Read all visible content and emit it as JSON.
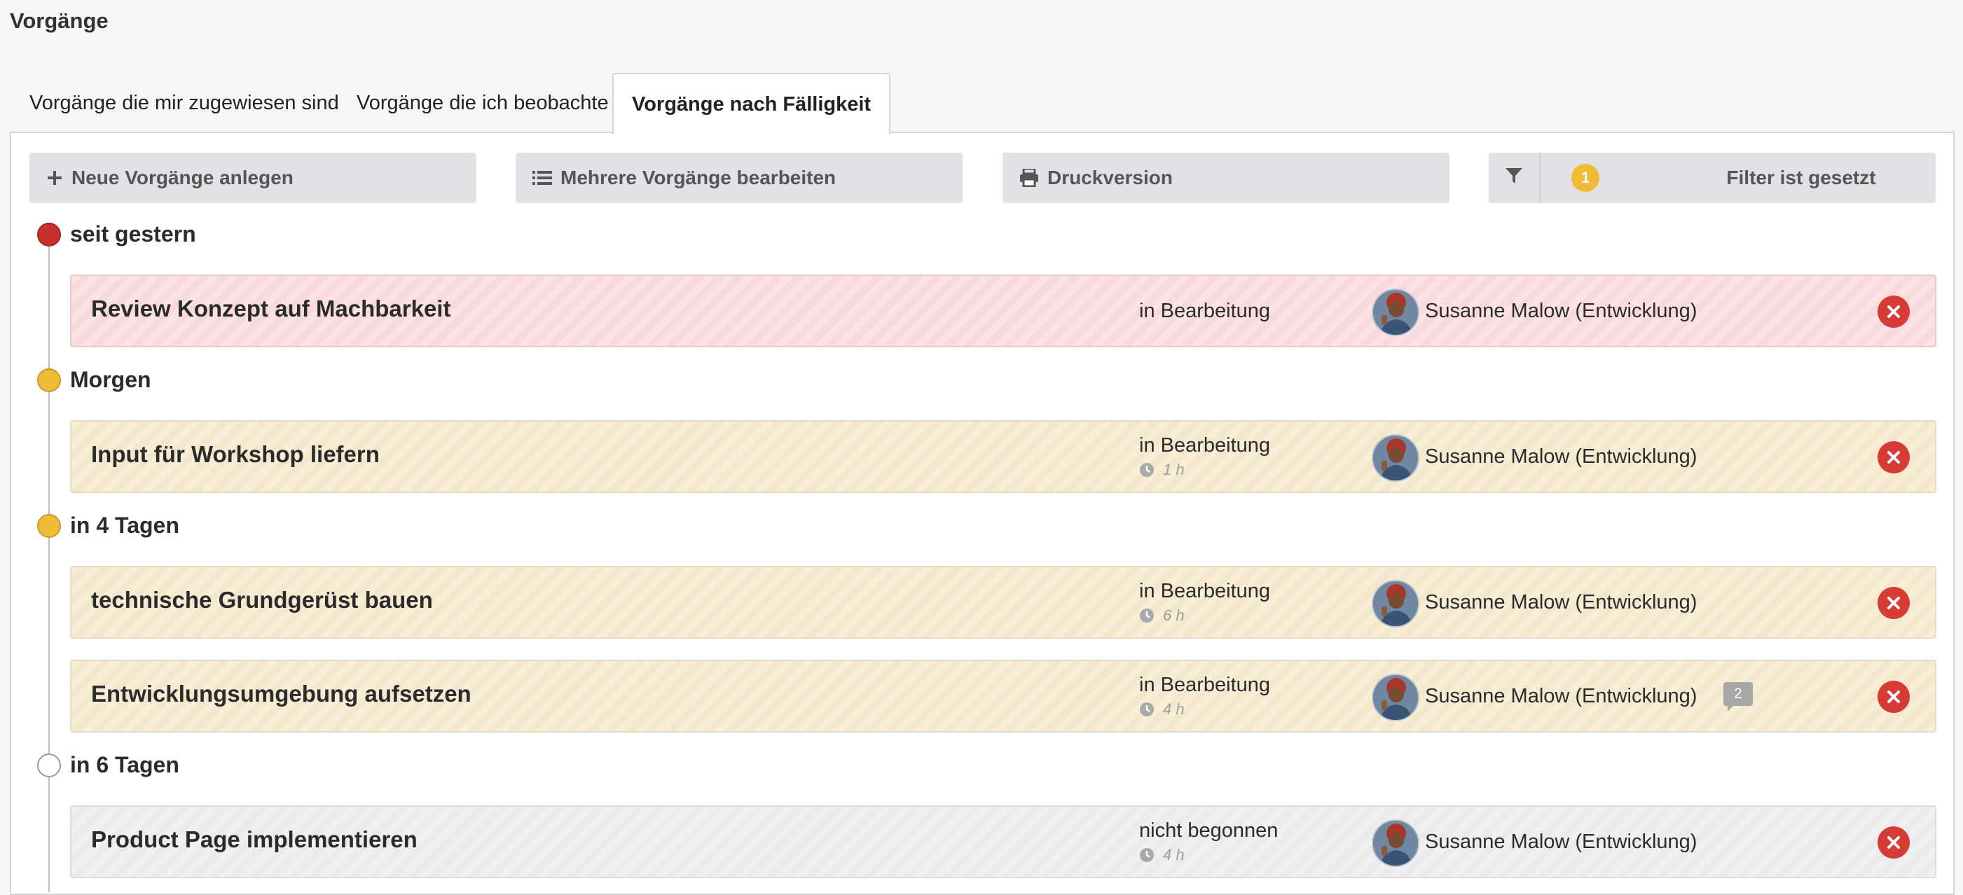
{
  "page": {
    "title": "Vorgänge"
  },
  "tabs": [
    {
      "label": "Vorgänge die mir zugewiesen sind"
    },
    {
      "label": "Vorgänge die ich beobachte"
    },
    {
      "label": "Vorgänge nach Fälligkeit",
      "active": true
    }
  ],
  "toolbar": {
    "new_label": "Neue Vorgänge anlegen",
    "bulk_label": "Mehrere Vorgänge bearbeiten",
    "print_label": "Druckversion",
    "filter_count": "1",
    "filter_label": "Filter ist gesetzt"
  },
  "colors": {
    "overdue": "#c9302c",
    "soon": "#f0bc38",
    "later": "#ffffff",
    "delete": "#d63b36"
  },
  "groups": [
    {
      "label": "seit gestern",
      "status_color": "overdue",
      "tasks": [
        {
          "title": "Review Konzept auf Machbarkeit",
          "status": "in Bearbeitung",
          "time": "",
          "assignee": "Susanne Malow (Entwicklung)",
          "comments": ""
        }
      ]
    },
    {
      "label": "Morgen",
      "status_color": "soon",
      "tasks": [
        {
          "title": "Input für Workshop liefern",
          "status": "in Bearbeitung",
          "time": "1 h",
          "assignee": "Susanne Malow (Entwicklung)",
          "comments": ""
        }
      ]
    },
    {
      "label": "in 4 Tagen",
      "status_color": "soon",
      "tasks": [
        {
          "title": "technische Grundgerüst bauen",
          "status": "in Bearbeitung",
          "time": "6 h",
          "assignee": "Susanne Malow (Entwicklung)",
          "comments": ""
        },
        {
          "title": "Entwicklungsumgebung aufsetzen",
          "status": "in Bearbeitung",
          "time": "4 h",
          "assignee": "Susanne Malow (Entwicklung)",
          "comments": "2"
        }
      ]
    },
    {
      "label": "in 6 Tagen",
      "status_color": "later",
      "tasks": [
        {
          "title": "Product Page implementieren",
          "status": "nicht begonnen",
          "time": "4 h",
          "assignee": "Susanne Malow (Entwicklung)",
          "comments": ""
        }
      ]
    }
  ]
}
